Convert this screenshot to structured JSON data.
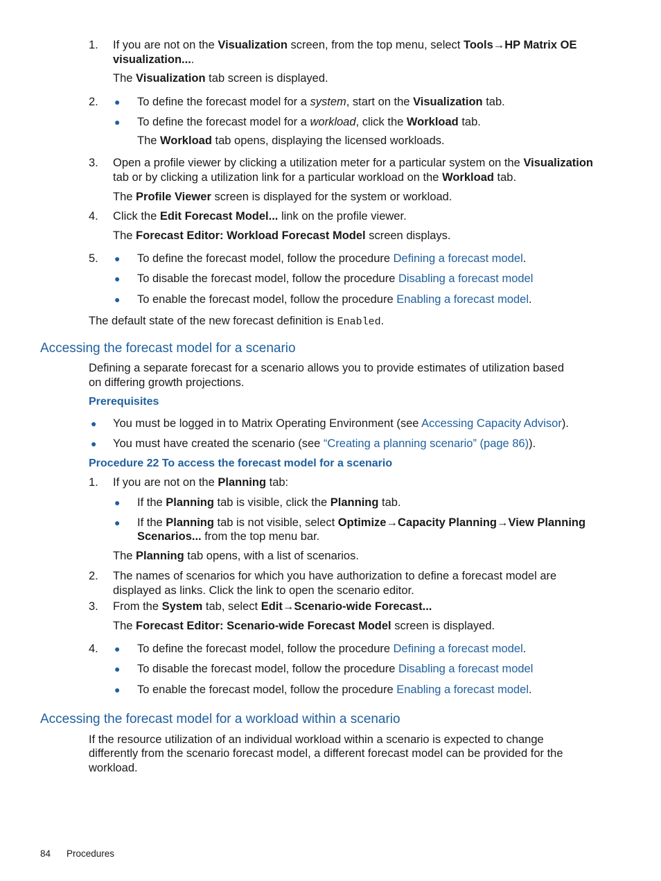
{
  "steps_a": {
    "s1": {
      "num": "1.",
      "pre": "If you are not on the ",
      "b1": "Visualization",
      "mid": " screen, from the top menu, select ",
      "b2": "Tools",
      "arrow": "→",
      "b3": "HP Matrix OE",
      "line2b": "visualization...",
      "line2": ".",
      "note_pre": "The ",
      "note_b": "Visualization",
      "note_post": " tab screen is displayed."
    },
    "s2": {
      "num": "2.",
      "bullet1_pre": "To define the forecast model for a ",
      "bullet1_i": "system",
      "bullet1_mid": ", start on the ",
      "bullet1_b": "Visualization",
      "bullet1_post": " tab.",
      "bullet2_pre": "To define the forecast model for a ",
      "bullet2_i": "workload",
      "bullet2_mid": ", click the ",
      "bullet2_b": "Workload",
      "bullet2_post": " tab.",
      "note_pre": "The ",
      "note_b": "Workload",
      "note_post": " tab opens, displaying the licensed workloads."
    },
    "s3": {
      "num": "3.",
      "l1_pre": "Open a profile viewer by clicking a utilization meter for a particular system on the ",
      "l1_b": "Visualization",
      "l2_pre": "tab or by clicking a utilization link for a particular workload on the ",
      "l2_b": "Workload",
      "l2_post": " tab.",
      "note_pre": "The ",
      "note_b": "Profile Viewer",
      "note_post": " screen is displayed for the system or workload."
    },
    "s4": {
      "num": "4.",
      "pre": "Click the ",
      "b": "Edit Forecast Model...",
      "post": " link on the profile viewer.",
      "note_pre": "The ",
      "note_b": "Forecast Editor: Workload Forecast Model",
      "note_post": " screen displays."
    },
    "s5": {
      "num": "5.",
      "items": [
        {
          "pre": "To define the forecast model, follow the procedure ",
          "link": "Defining a forecast model",
          "post": "."
        },
        {
          "pre": "To disable the forecast model, follow the procedure ",
          "link": "Disabling a forecast model",
          "post": ""
        },
        {
          "pre": "To enable the forecast model, follow the procedure ",
          "link": "Enabling a forecast model",
          "post": "."
        }
      ]
    },
    "default_pre": "The default state of the new forecast definition is ",
    "default_code": "Enabled",
    "default_post": "."
  },
  "section1": {
    "heading": "Accessing the forecast model for a scenario",
    "intro_l1": "Defining a separate forecast for a scenario allows you to provide estimates of utilization based",
    "intro_l2": "on differing growth projections.",
    "prereq_heading": "Prerequisites",
    "prereqs": [
      {
        "pre": "You must be logged in to Matrix Operating Environment (see ",
        "link": "Accessing Capacity Advisor",
        "post": ")."
      },
      {
        "pre": "You must have created the scenario (see ",
        "link": "“Creating a planning scenario” (page 86)",
        "post": ")."
      }
    ],
    "procedure_heading": "Procedure 22 To access the forecast model for a scenario",
    "p1": {
      "num": "1.",
      "pre": "If you are not on the ",
      "b": "Planning",
      "post": " tab:",
      "b1_pre": "If the ",
      "b1_b": "Planning",
      "b1_mid": " tab is visible, click the ",
      "b1_b2": "Planning",
      "b1_post": " tab.",
      "b2_pre": "If the ",
      "b2_b": "Planning",
      "b2_mid": " tab is not visible, select ",
      "b2_b2": "Optimize",
      "arrow": "→",
      "b2_b3": "Capacity Planning",
      "b2_b4": "View Planning",
      "b2_l2b": "Scenarios...",
      "b2_l2": " from the top menu bar.",
      "note_pre": "The ",
      "note_b": "Planning",
      "note_post": " tab opens, with a list of scenarios."
    },
    "p2": {
      "num": "2.",
      "l1": "The names of scenarios for which you have authorization to define a forecast model are",
      "l2": "displayed as links. Click the link to open the scenario editor."
    },
    "p3": {
      "num": "3.",
      "pre": "From the ",
      "b": "System",
      "mid": " tab, select ",
      "b2": "Edit",
      "arrow": "→",
      "b3": "Scenario-wide Forecast...",
      "note_pre": "The ",
      "note_b": "Forecast Editor: Scenario-wide Forecast Model",
      "note_post": " screen is displayed."
    },
    "p4": {
      "num": "4.",
      "items": [
        {
          "pre": "To define the forecast model, follow the procedure ",
          "link": "Defining a forecast model",
          "post": "."
        },
        {
          "pre": "To disable the forecast model, follow the procedure ",
          "link": "Disabling a forecast model",
          "post": ""
        },
        {
          "pre": "To enable the forecast model, follow the procedure ",
          "link": "Enabling a forecast model",
          "post": "."
        }
      ]
    }
  },
  "section2": {
    "heading": "Accessing the forecast model for a workload within a scenario",
    "l1": "If the resource utilization of an individual workload within a scenario is expected to change",
    "l2": "differently from the scenario forecast model, a different forecast model can be provided for the",
    "l3": "workload."
  },
  "footer": {
    "page": "84",
    "section": "Procedures"
  }
}
